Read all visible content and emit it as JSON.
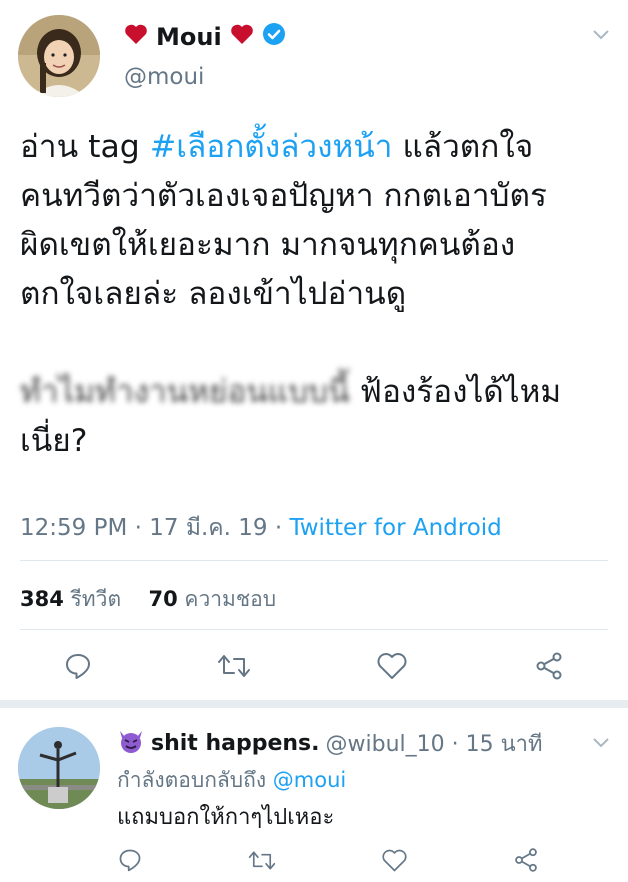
{
  "tweet": {
    "author_name": "Moui",
    "author_handle": "@moui",
    "lines": [
      {
        "pre": "อ่าน tag ",
        "hashtag": "#เลือกตั้งล่วงหน้า",
        "post": " แล้วตกใจ"
      },
      {
        "text": "คนทวีตว่าตัวเองเจอปัญหา กกตเอาบัตร"
      },
      {
        "text": "ผิดเขตให้เยอะมาก มากจนทุกคนต้อง"
      },
      {
        "text": "ตกใจเลยล่ะ ลองเข้าไปอ่านดู"
      }
    ],
    "blurred_text": "ทำไมทำงานหย่อนแบบนี้",
    "line5_text": " ฟ้องร้องได้ไหม",
    "line6_text": "เนี่ย?",
    "timestamp": "12:59 PM · 17 มี.ค. 19 · ",
    "source": "Twitter for Android",
    "retweet_count": "384",
    "retweet_label": "รีทวีต",
    "like_count": "70",
    "like_label": "ความชอบ"
  },
  "reply": {
    "name": "shit happens.",
    "handle_time": "@wibul_10 · 15 นาที",
    "replying_to_label": "กำลังตอบกลับถึง ",
    "replying_to_handle": "@moui",
    "text": "แถมบอกให้กาๆไปเหอะ"
  },
  "colors": {
    "accent": "#1da1f2",
    "heart_emoji": "#c8102e",
    "secondary_text": "#657786",
    "devil_emoji": "#8e5bd0"
  },
  "icons": [
    "heart-icon",
    "verified-badge-icon",
    "chevron-down-icon",
    "reply-icon",
    "retweet-icon",
    "like-icon",
    "share-icon",
    "devil-emoji-icon"
  ]
}
